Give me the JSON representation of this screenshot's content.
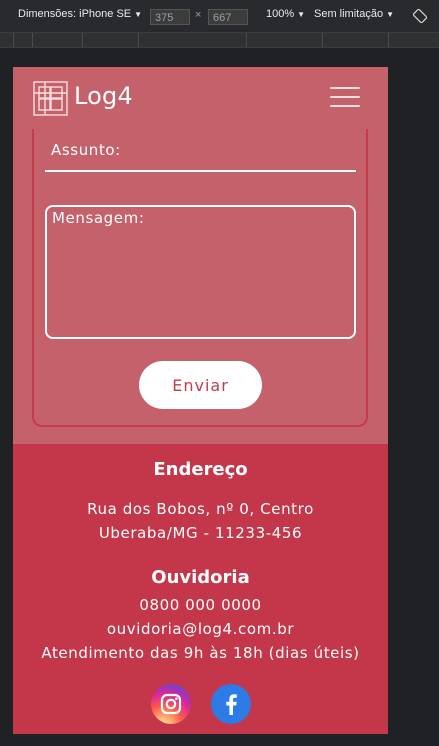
{
  "devtools": {
    "dimensions_label": "Dimensões: iPhone SE",
    "width_value": "375",
    "times": "×",
    "height_value": "667",
    "zoom_label": "100%",
    "throttle_label": "Sem limitação",
    "caret": "▼"
  },
  "navbar": {
    "logo_text": "Log4",
    "menu_icon": "hamburger-icon"
  },
  "form": {
    "subject_label": "Assunto:",
    "message_label": "Mensagem:",
    "send_label": "Enviar"
  },
  "footer": {
    "address_title": "Endereço",
    "address_line1": "Rua dos Bobos, nº 0, Centro",
    "address_line2": "Uberaba/MG - 11233-456",
    "ombudsman_title": "Ouvidoria",
    "phone": "0800 000 0000",
    "email": "ouvidoria@log4.com.br",
    "hours": "Atendimento das 9h às 18h (dias úteis)",
    "social": [
      {
        "name": "instagram-icon"
      },
      {
        "name": "facebook-icon"
      }
    ]
  },
  "colors": {
    "page_bg": "#c5616b",
    "footer_bg": "#c43649",
    "accent": "#c43c4c",
    "text": "#ffffff"
  }
}
